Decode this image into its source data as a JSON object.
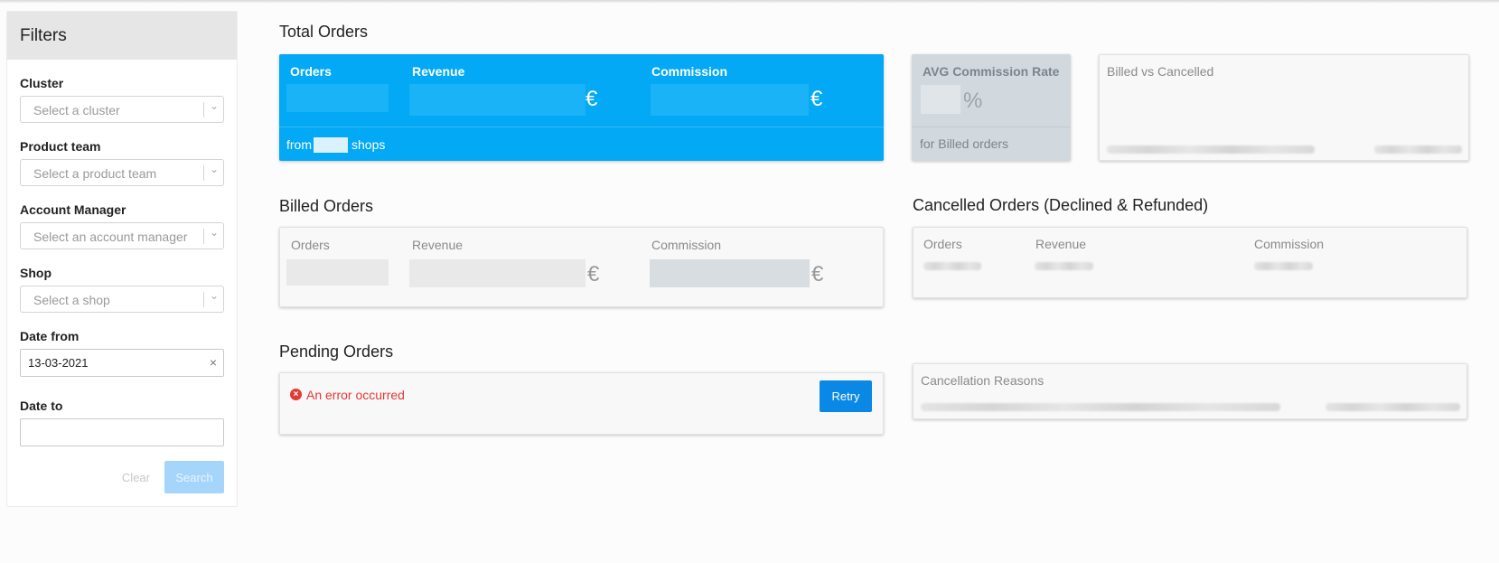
{
  "filters": {
    "title": "Filters",
    "cluster": {
      "label": "Cluster",
      "placeholder": "Select a cluster"
    },
    "product_team": {
      "label": "Product team",
      "placeholder": "Select a product team"
    },
    "account_manager": {
      "label": "Account Manager",
      "placeholder": "Select an account manager"
    },
    "shop": {
      "label": "Shop",
      "placeholder": "Select a shop"
    },
    "date_from": {
      "label": "Date from",
      "value": "13-03-2021"
    },
    "date_to": {
      "label": "Date to",
      "value": ""
    },
    "clear_label": "Clear",
    "search_label": "Search"
  },
  "total_orders": {
    "title": "Total Orders",
    "orders_label": "Orders",
    "revenue_label": "Revenue",
    "commission_label": "Commission",
    "currency": "€",
    "from_label": "from",
    "shops_label": "shops"
  },
  "avg_commission": {
    "label": "AVG Commission Rate",
    "percent": "%",
    "footer": "for Billed orders"
  },
  "billed_vs_cancelled": {
    "label": "Billed vs Cancelled"
  },
  "billed_orders": {
    "title": "Billed Orders",
    "orders_label": "Orders",
    "revenue_label": "Revenue",
    "commission_label": "Commission",
    "currency": "€"
  },
  "cancelled_orders": {
    "title": "Cancelled Orders (Declined & Refunded)",
    "orders_label": "Orders",
    "revenue_label": "Revenue",
    "commission_label": "Commission"
  },
  "pending_orders": {
    "title": "Pending Orders",
    "error_text": "An error occurred",
    "retry_label": "Retry"
  },
  "cancellation_reasons": {
    "label": "Cancellation Reasons"
  },
  "colors": {
    "primary": "#03a9f4",
    "retry": "#0a88e6",
    "error": "#e53935"
  }
}
